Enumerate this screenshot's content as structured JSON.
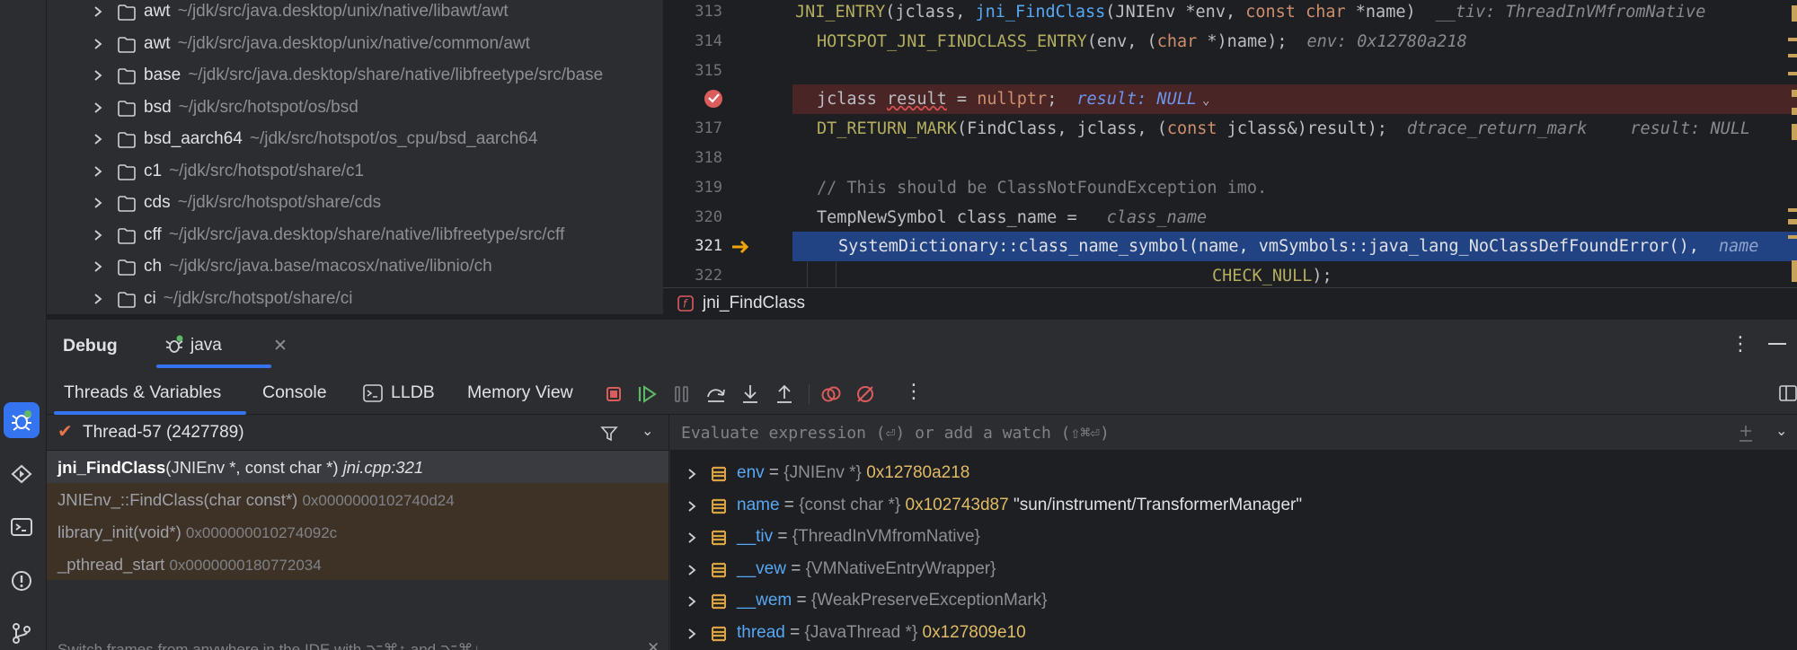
{
  "project_tree": {
    "rows": [
      {
        "name": "awt",
        "path": "~/jdk/src/java.desktop/unix/native/libawt/awt"
      },
      {
        "name": "awt",
        "path": "~/jdk/src/java.desktop/unix/native/common/awt"
      },
      {
        "name": "base",
        "path": "~/jdk/src/java.desktop/share/native/libfreetype/src/base"
      },
      {
        "name": "bsd",
        "path": "~/jdk/src/hotspot/os/bsd"
      },
      {
        "name": "bsd_aarch64",
        "path": "~/jdk/src/hotspot/os_cpu/bsd_aarch64"
      },
      {
        "name": "c1",
        "path": "~/jdk/src/hotspot/share/c1"
      },
      {
        "name": "cds",
        "path": "~/jdk/src/hotspot/share/cds"
      },
      {
        "name": "cff",
        "path": "~/jdk/src/java.desktop/share/native/libfreetype/src/cff"
      },
      {
        "name": "ch",
        "path": "~/jdk/src/java.base/macosx/native/libnio/ch"
      },
      {
        "name": "ci",
        "path": "~/jdk/src/hotspot/share/ci"
      }
    ]
  },
  "editor": {
    "line_numbers": [
      "313",
      "314",
      "315",
      "",
      "317",
      "318",
      "319",
      "320",
      "321",
      "322"
    ],
    "l313": {
      "macro": "JNI_ENTRY",
      "p1": "(jclass, ",
      "fn": "jni_FindClass",
      "p2": "(JNIEnv *env, ",
      "kw1": "const",
      "sp": " ",
      "kw2": "char",
      "p3": " *name)",
      "hint": "__tiv: ThreadInVMfromNative"
    },
    "l314": {
      "macro": "HOTSPOT_JNI_FINDCLASS_ENTRY",
      "p1": "(env, (",
      "kw": "char",
      "p2": " *)name);",
      "hint": "env: 0x12780a218"
    },
    "l316": {
      "p1": "jclass ",
      "var": "result",
      "p2": " = ",
      "kw": "nullptr",
      "p3": ";",
      "hint": "result: NULL"
    },
    "l317": {
      "macro": "DT_RETURN_MARK",
      "p1": "(FindClass, jclass, (",
      "kw": "const",
      "p2": " jclass&)result);",
      "hint1": "dtrace_return_mark",
      "hint2": "result: NULL"
    },
    "l319": {
      "comment": "// This should be ClassNotFoundException imo."
    },
    "l320": {
      "p1": "TempNewSymbol class_name = ",
      "hint": "class_name"
    },
    "l321": {
      "code": "SystemDictionary::class_name_symbol(name, vmSymbols::java_lang_NoClassDefFoundError(),",
      "hint": "name"
    },
    "l322": {
      "macro": "CHECK_NULL",
      "p1": ");"
    },
    "breadcrumb": "jni_FindClass"
  },
  "debug": {
    "title": "Debug",
    "session_tab": "java",
    "tabs": [
      "Threads & Variables",
      "Console",
      "LLDB",
      "Memory View"
    ],
    "thread": "Thread-57 (2427789)",
    "frames": [
      {
        "fn": "jni_FindClass",
        "args": "(JNIEnv *, const char *)",
        "loc": "jni.cpp:321"
      },
      {
        "fn": "JNIEnv_::FindClass(char const*)",
        "addr": "0x0000000102740d24"
      },
      {
        "fn": "library_init(void*)",
        "addr": "0x000000010274092c"
      },
      {
        "fn": "_pthread_start",
        "addr": "0x0000000180772034"
      }
    ],
    "frames_tip": "Switch frames from anywhere in the IDE with ⌥⌘↑ and ⌥⌘↓",
    "eval_placeholder": "Evaluate expression (⏎) or add a watch (⇧⌘⏎)",
    "variables": [
      {
        "name": "env",
        "type": "{JNIEnv *}",
        "value": "0x12780a218",
        "str": ""
      },
      {
        "name": "name",
        "type": "{const char *}",
        "value": "0x102743d87",
        "str": "\"sun/instrument/TransformerManager\""
      },
      {
        "name": "__tiv",
        "type": "{ThreadInVMfromNative}",
        "value": "",
        "str": ""
      },
      {
        "name": "__vew",
        "type": "{VMNativeEntryWrapper}",
        "value": "",
        "str": ""
      },
      {
        "name": "__wem",
        "type": "{WeakPreserveExceptionMark}",
        "value": "",
        "str": ""
      },
      {
        "name": "thread",
        "type": "{JavaThread *}",
        "value": "0x127809e10",
        "str": ""
      }
    ]
  },
  "colors": {
    "accent": "#3574f0",
    "breakpoint": "#db5c5c",
    "exec_line": "#214283"
  },
  "icons": [
    "bug-icon",
    "run-icon",
    "terminal-icon",
    "problems-icon",
    "git-icon",
    "folder-icon",
    "chevron-right-icon",
    "field-icon",
    "stop-icon",
    "resume-icon",
    "pause-icon",
    "step-over-icon",
    "step-into-icon",
    "step-out-icon",
    "view-breakpoints-icon",
    "mute-breakpoints-icon",
    "more-icon",
    "filter-icon",
    "watch-icon",
    "layout-icon",
    "function-icon"
  ]
}
